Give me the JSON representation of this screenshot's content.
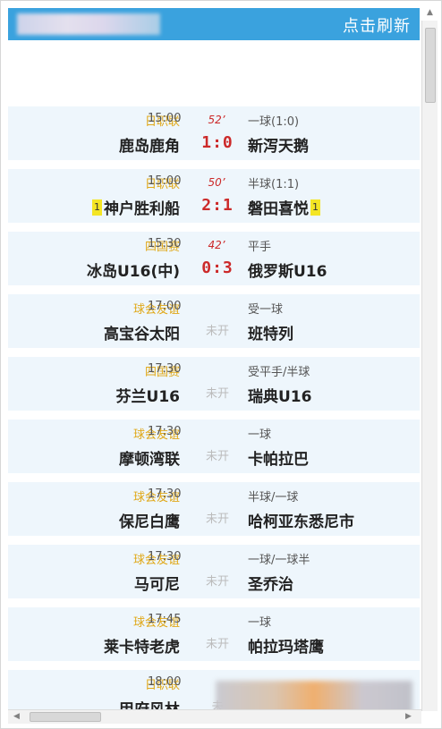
{
  "header": {
    "refresh_label": "点击刷新"
  },
  "matches": [
    {
      "league": "日职联",
      "time": "15:00",
      "minute": "52’",
      "score": "1:0",
      "home": "鹿岛鹿角",
      "odds": "一球(1:0)",
      "away": "新泻天鹅",
      "home_card": "",
      "away_card": ""
    },
    {
      "league": "日职联",
      "time": "15:00",
      "minute": "50’",
      "score": "2:1",
      "home": "神户胜利船",
      "odds": "半球(1:1)",
      "away": "磐田喜悦",
      "home_card": "1",
      "away_card": "1"
    },
    {
      "league": "四国赛",
      "time": "15:30",
      "minute": "42’",
      "score": "0:3",
      "home": "冰岛U16(中)",
      "odds": "平手",
      "away": "俄罗斯U16",
      "home_card": "",
      "away_card": ""
    },
    {
      "league": "球会友谊",
      "time": "17:00",
      "status": "未开",
      "home": "高宝谷太阳",
      "odds": "受一球",
      "away": "班特列"
    },
    {
      "league": "四国赛",
      "time": "17:30",
      "status": "未开",
      "home": "芬兰U16",
      "odds": "受平手/半球",
      "away": "瑞典U16"
    },
    {
      "league": "球会友谊",
      "time": "17:30",
      "status": "未开",
      "home": "摩顿湾联",
      "odds": "一球",
      "away": "卡帕拉巴"
    },
    {
      "league": "球会友谊",
      "time": "17:30",
      "status": "未开",
      "home": "保尼白鹰",
      "odds": "半球/一球",
      "away": "哈柯亚东悉尼市"
    },
    {
      "league": "球会友谊",
      "time": "17:30",
      "status": "未开",
      "home": "马可尼",
      "odds": "一球/一球半",
      "away": "圣乔治"
    },
    {
      "league": "球会友谊",
      "time": "17:45",
      "status": "未开",
      "home": "莱卡特老虎",
      "odds": "一球",
      "away": "帕拉玛塔鹰"
    },
    {
      "league": "日职联",
      "time": "18:00",
      "status": "未",
      "home": "甲府风林",
      "odds": "",
      "away": ""
    }
  ],
  "colors": {
    "header_bg": "#3aa2de",
    "row_bg": "#eef6fc",
    "league": "#e0a818",
    "live": "#cc2a2a",
    "card": "#f4e524"
  }
}
